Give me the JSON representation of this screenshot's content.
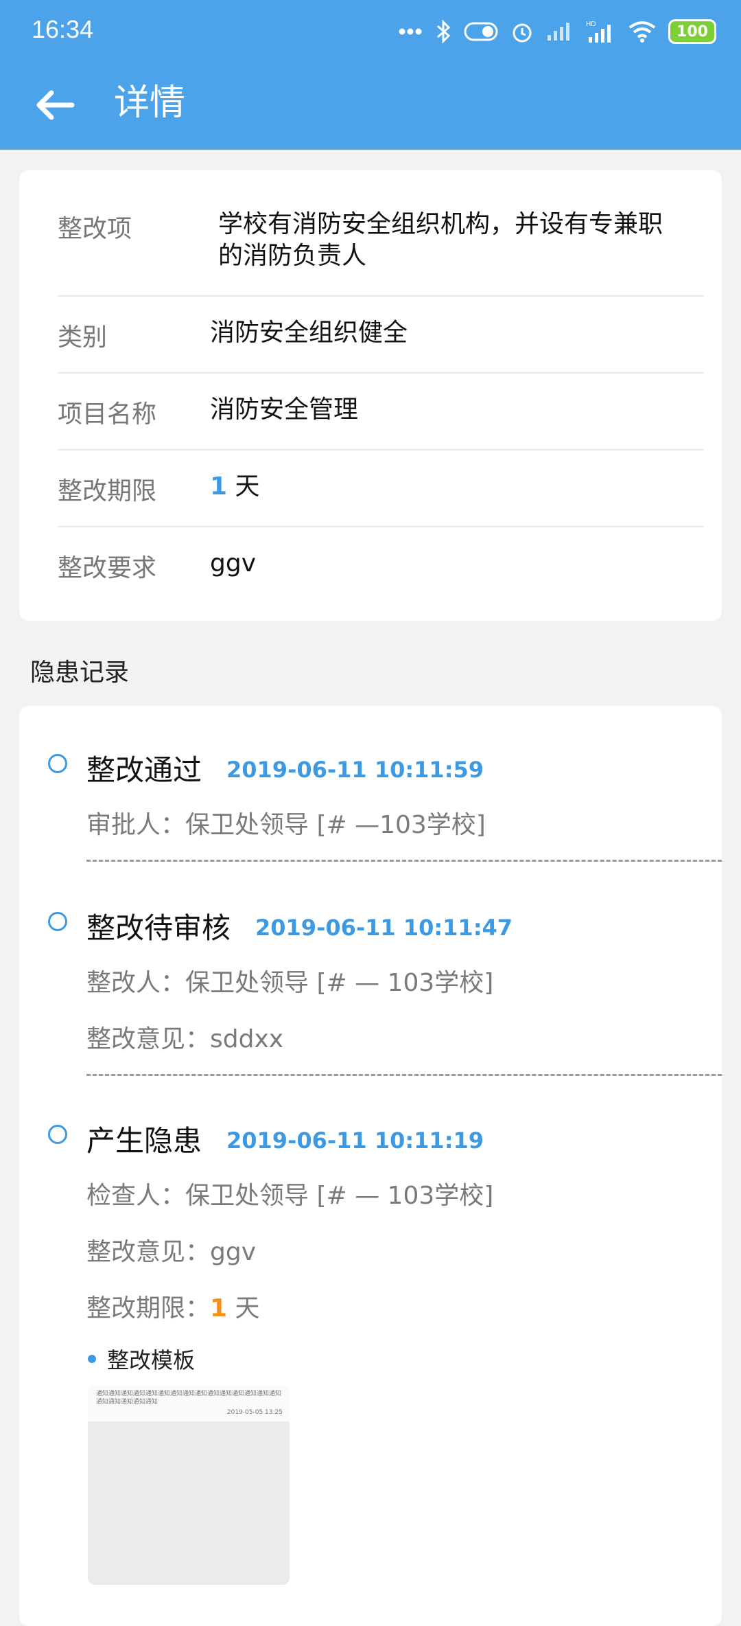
{
  "status_bar": {
    "time": "16:34",
    "battery": "100"
  },
  "app_bar": {
    "title": "详情"
  },
  "detail": {
    "rows": [
      {
        "label": "整改项",
        "value": "学校有消防安全组织机构，并设有专兼职的消防负责人"
      },
      {
        "label": "类别",
        "value": "消防安全组织健全"
      },
      {
        "label": "项目名称",
        "value": "消防安全管理"
      },
      {
        "label": "整改期限",
        "value_num": "1",
        "value_unit": "天"
      },
      {
        "label": "整改要求",
        "value": "ggv"
      }
    ]
  },
  "records_section_title": "隐患记录",
  "records": [
    {
      "status": "整改通过",
      "time": "2019-06-11 10:11:59",
      "lines": [
        "审批人：保卫处领导 [# —103学校]"
      ]
    },
    {
      "status": "整改待审核",
      "time": "2019-06-11 10:11:47",
      "lines": [
        "整改人：保卫处领导 [# — 103学校]",
        "整改意见：sddxx"
      ]
    },
    {
      "status": "产生隐患",
      "time": "2019-06-11 10:11:19",
      "lines": [
        "检查人：保卫处领导 [# — 103学校]",
        "整改意见：ggv"
      ],
      "deadline_label": "整改期限：",
      "deadline_num": "1",
      "deadline_unit": "天",
      "template_label": "整改模板",
      "thumbnail": {
        "text": "通知通知通知通知通知通知通知通知通知通知通知通知通知通知通知通知通知通知通知通知",
        "date": "2019-05-05 13:25"
      }
    }
  ],
  "colors": {
    "app_bar": "#4da3ea",
    "accent_blue": "#3d9ae2",
    "accent_orange": "#f7911e"
  }
}
